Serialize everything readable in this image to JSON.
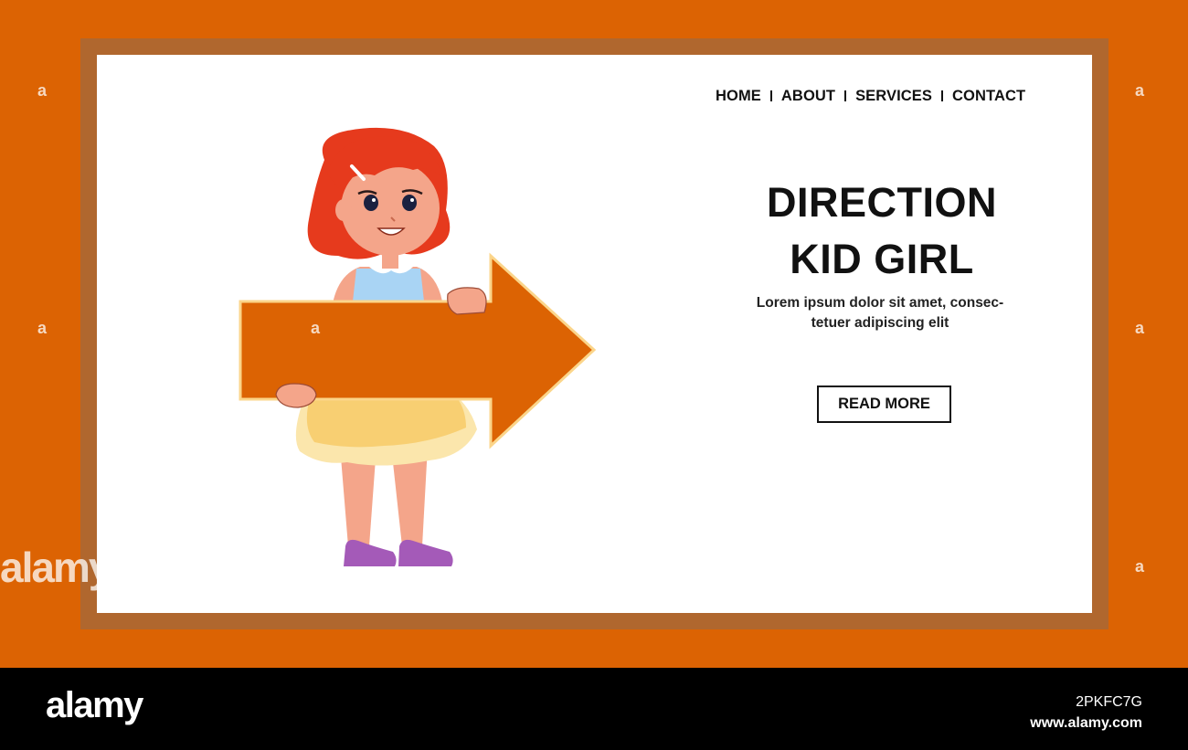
{
  "nav": {
    "items": [
      "HOME",
      "ABOUT",
      "SERVICES",
      "CONTACT"
    ]
  },
  "hero": {
    "headline_line1": "DIRECTION",
    "headline_line2": "KID GIRL",
    "tagline_line1": "Lorem ipsum dolor sit amet, consec-",
    "tagline_line2": "tetuer adipiscing elit",
    "cta_label": "READ MORE"
  },
  "watermark": {
    "mark": "a",
    "brand": "alamy"
  },
  "footer": {
    "brand": "alamy",
    "image_id": "2PKFC7G",
    "url": "www.alamy.com"
  },
  "colors": {
    "background": "#dc6303",
    "frame": "#b0672e",
    "card": "#ffffff",
    "arrow": "#dc6303",
    "hair": "#e63a1d"
  },
  "icons": [
    "right-arrow-sign"
  ]
}
